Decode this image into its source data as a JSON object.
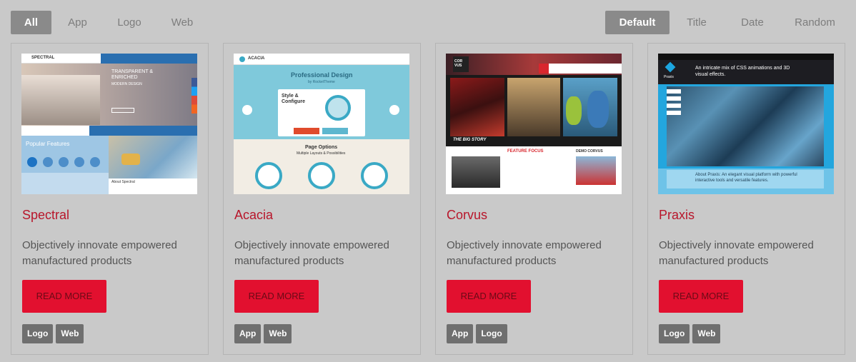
{
  "filters": [
    {
      "label": "All",
      "active": true
    },
    {
      "label": "App",
      "active": false
    },
    {
      "label": "Logo",
      "active": false
    },
    {
      "label": "Web",
      "active": false
    }
  ],
  "sorts": [
    {
      "label": "Default",
      "active": true
    },
    {
      "label": "Title",
      "active": false
    },
    {
      "label": "Date",
      "active": false
    },
    {
      "label": "Random",
      "active": false
    }
  ],
  "cards": [
    {
      "title": "Spectral",
      "description": "Objectively innovate empowered manufactured products",
      "button": "READ MORE",
      "tags": [
        "Logo",
        "Web"
      ],
      "preview": {
        "brand": "SPECTRAL",
        "headline": "TRANSPARENT & ENRICHED",
        "sub": "MODERN DESIGN",
        "section": "Popular Features",
        "about": "About Spectral"
      }
    },
    {
      "title": "Acacia",
      "description": "Objectively innovate empowered manufactured products",
      "button": "READ MORE",
      "tags": [
        "App",
        "Web"
      ],
      "preview": {
        "brand": "ACACIA",
        "headline": "Professional Design",
        "sub": "by RocketTheme",
        "box": "Style & Configure",
        "options": "Page Options",
        "options_sub": "Multiple Layouts & Possibilities"
      }
    },
    {
      "title": "Corvus",
      "description": "Objectively innovate empowered manufactured products",
      "button": "READ MORE",
      "tags": [
        "App",
        "Logo"
      ],
      "preview": {
        "brand": "COR VUS",
        "story": "THE BIG STORY",
        "feature": "FEATURE FOCUS",
        "demo": "DEMO CORVUS"
      }
    },
    {
      "title": "Praxis",
      "description": "Objectively innovate empowered manufactured products",
      "button": "READ MORE",
      "tags": [
        "Logo",
        "Web"
      ],
      "preview": {
        "brand": "Praxis",
        "headline": "An intricate mix of CSS animations and 3D visual effects.",
        "about": "About Praxis: An elegant visual platform with powerful interactive tools and versatile features."
      }
    }
  ],
  "colors": {
    "accent": "#e2102f",
    "title": "#b8162b",
    "background": "#c9c9c9"
  }
}
